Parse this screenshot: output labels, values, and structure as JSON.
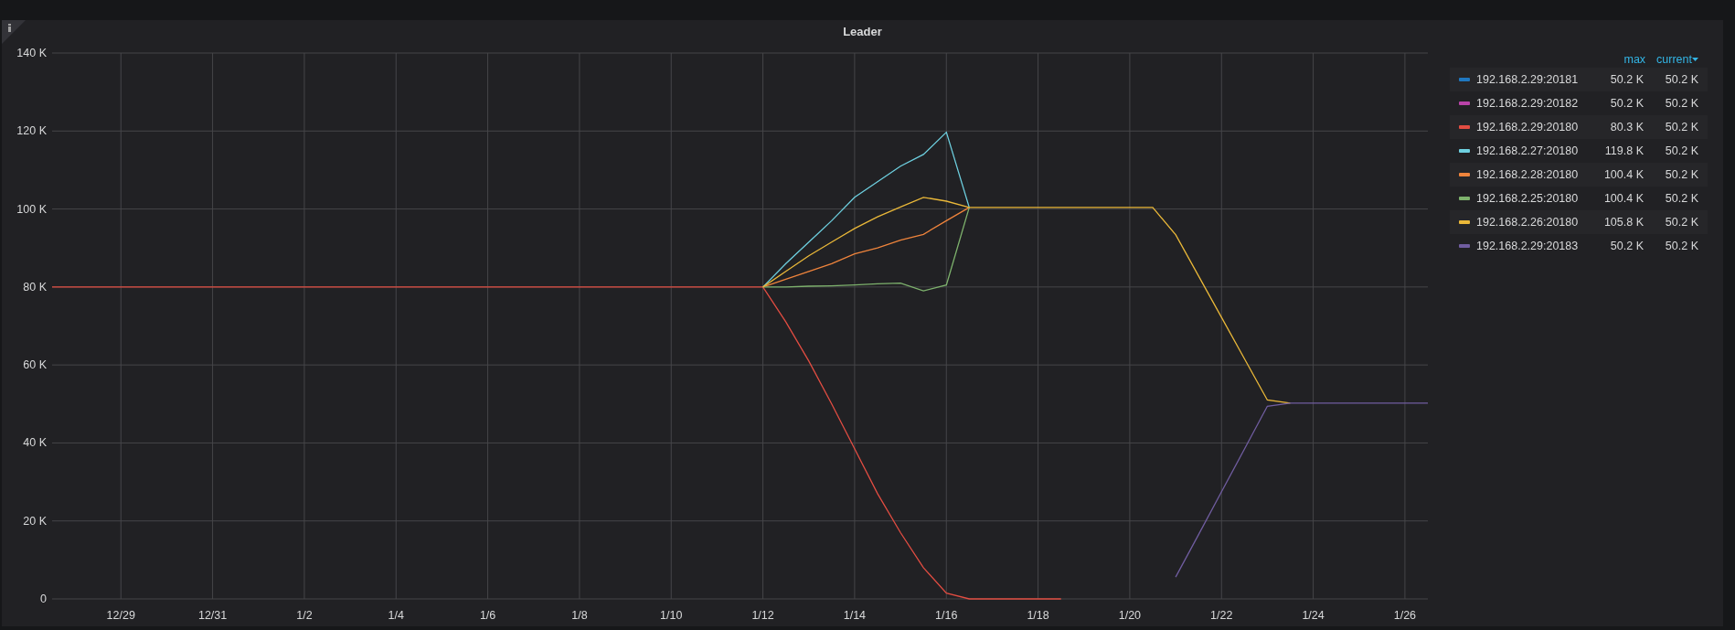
{
  "panel": {
    "title": "Leader",
    "chart_data": {
      "type": "line",
      "categories": [
        null,
        null,
        null,
        "12/29",
        null,
        null,
        null,
        "12/31",
        null,
        null,
        null,
        "1/2",
        null,
        null,
        null,
        "1/4",
        null,
        null,
        null,
        "1/6",
        null,
        null,
        null,
        "1/8",
        null,
        null,
        null,
        "1/10",
        null,
        null,
        null,
        "1/12",
        null,
        null,
        null,
        "1/14",
        null,
        null,
        null,
        "1/16",
        null,
        null,
        null,
        "1/18",
        null,
        null,
        null,
        "1/20",
        null,
        null,
        null,
        "1/22",
        null,
        null,
        null,
        "1/24",
        null,
        null,
        null,
        "1/26",
        null
      ],
      "series": [
        {
          "name": "192.168.2.29:20181",
          "color": "#1f78c1",
          "values": [
            null,
            null,
            null,
            null,
            null,
            null,
            null,
            null,
            null,
            null,
            null,
            null,
            null,
            null,
            null,
            null,
            null,
            null,
            null,
            null,
            null,
            null,
            null,
            null,
            null,
            null,
            null,
            null,
            null,
            null,
            null,
            null,
            null,
            null,
            null,
            null,
            null,
            null,
            null,
            null,
            null,
            null,
            null,
            null,
            null,
            null,
            null,
            null,
            null,
            null,
            null,
            null,
            null,
            null,
            null,
            null,
            null,
            null,
            null,
            null,
            null
          ]
        },
        {
          "name": "192.168.2.29:20182",
          "color": "#ba43a9",
          "values": [
            null,
            null,
            null,
            null,
            null,
            null,
            null,
            null,
            null,
            null,
            null,
            null,
            null,
            null,
            null,
            null,
            null,
            null,
            null,
            null,
            null,
            null,
            null,
            null,
            null,
            null,
            null,
            null,
            null,
            null,
            null,
            null,
            null,
            null,
            null,
            null,
            null,
            null,
            null,
            null,
            null,
            null,
            null,
            null,
            null,
            null,
            null,
            null,
            null,
            null,
            null,
            null,
            null,
            null,
            null,
            null,
            null,
            null,
            null,
            null,
            null
          ]
        },
        {
          "name": "192.168.2.29:20180",
          "color": "#e24d42",
          "values": [
            80,
            80,
            80,
            80,
            80,
            80,
            80,
            80,
            80,
            80,
            80,
            80,
            80,
            80,
            80,
            80,
            80,
            80,
            80,
            80,
            80,
            80,
            80,
            80,
            80,
            80,
            80,
            80,
            80,
            80,
            80,
            80,
            71,
            61,
            50,
            38.5,
            27,
            17,
            8,
            1.5,
            0,
            0,
            0,
            0,
            0,
            null,
            null,
            null,
            null,
            null,
            null,
            null,
            null,
            null,
            null,
            null,
            null,
            null,
            null,
            null,
            null
          ]
        },
        {
          "name": "192.168.2.27:20180",
          "color": "#6ed0e0",
          "values": [
            null,
            null,
            null,
            null,
            null,
            null,
            null,
            null,
            null,
            null,
            null,
            null,
            null,
            null,
            null,
            null,
            null,
            null,
            null,
            null,
            null,
            null,
            null,
            null,
            null,
            null,
            null,
            null,
            null,
            null,
            null,
            80,
            86,
            91.5,
            97,
            103,
            107,
            111,
            114,
            119.7,
            100.4,
            null,
            null,
            null,
            null,
            null,
            null,
            null,
            null,
            null,
            null,
            null,
            null,
            null,
            null,
            null,
            null,
            null,
            null,
            null,
            null
          ]
        },
        {
          "name": "192.168.2.28:20180",
          "color": "#ef843c",
          "values": [
            null,
            null,
            null,
            null,
            null,
            null,
            null,
            null,
            null,
            null,
            null,
            null,
            null,
            null,
            null,
            null,
            null,
            null,
            null,
            null,
            null,
            null,
            null,
            null,
            null,
            null,
            null,
            null,
            null,
            null,
            null,
            80,
            82,
            84,
            86,
            88.5,
            90,
            92,
            93.5,
            97,
            100.4,
            null,
            null,
            null,
            null,
            null,
            null,
            null,
            null,
            null,
            null,
            null,
            null,
            null,
            null,
            null,
            null,
            null,
            null,
            null,
            null
          ]
        },
        {
          "name": "192.168.2.25:20180",
          "color": "#7eb26d",
          "values": [
            null,
            null,
            null,
            null,
            null,
            null,
            null,
            null,
            null,
            null,
            null,
            null,
            null,
            null,
            null,
            null,
            null,
            null,
            null,
            null,
            null,
            null,
            null,
            null,
            null,
            null,
            null,
            null,
            null,
            null,
            null,
            80,
            80,
            80.2,
            80.3,
            80.5,
            80.8,
            81,
            79,
            80.5,
            100.4,
            null,
            null,
            null,
            null,
            null,
            null,
            null,
            null,
            null,
            null,
            null,
            null,
            null,
            null,
            null,
            null,
            null,
            null,
            null,
            null
          ]
        },
        {
          "name": "192.168.2.26:20180",
          "color": "#eab839",
          "values": [
            null,
            null,
            null,
            null,
            null,
            null,
            null,
            null,
            null,
            null,
            null,
            null,
            null,
            null,
            null,
            null,
            null,
            null,
            null,
            null,
            null,
            null,
            null,
            null,
            null,
            null,
            null,
            null,
            null,
            null,
            null,
            80,
            84,
            88,
            91.5,
            95,
            98,
            100.5,
            103,
            102,
            100.4,
            100.4,
            100.4,
            100.4,
            100.4,
            100.4,
            100.4,
            100.4,
            100.4,
            93.4,
            82.8,
            72.2,
            61.6,
            51,
            50.2,
            null,
            null,
            null,
            null,
            null,
            null
          ]
        },
        {
          "name": "192.168.2.29:20183",
          "color": "#705da0",
          "values": [
            null,
            null,
            null,
            null,
            null,
            null,
            null,
            null,
            null,
            null,
            null,
            null,
            null,
            null,
            null,
            null,
            null,
            null,
            null,
            null,
            null,
            null,
            null,
            null,
            null,
            null,
            null,
            null,
            null,
            null,
            null,
            null,
            null,
            null,
            null,
            null,
            null,
            null,
            null,
            null,
            null,
            null,
            null,
            null,
            null,
            null,
            null,
            null,
            null,
            5.6,
            16.5,
            27.5,
            38.4,
            49.4,
            50.2,
            50.2,
            50.2,
            50.2,
            50.2,
            50.2,
            50.2
          ]
        }
      ],
      "ylim": [
        0,
        140
      ],
      "grid": true,
      "yticks": [
        {
          "value": 0,
          "label": "0"
        },
        {
          "value": 20,
          "label": "20 K"
        },
        {
          "value": 40,
          "label": "40 K"
        },
        {
          "value": 60,
          "label": "60 K"
        },
        {
          "value": 80,
          "label": "80 K"
        },
        {
          "value": 100,
          "label": "100 K"
        },
        {
          "value": 120,
          "label": "120 K"
        },
        {
          "value": 140,
          "label": "140 K"
        }
      ]
    },
    "legend": {
      "columns": [
        {
          "label": "max",
          "sorted": false
        },
        {
          "label": "current",
          "sorted": true
        }
      ],
      "rows": [
        {
          "max": "50.2 K",
          "current": "50.2 K"
        },
        {
          "max": "50.2 K",
          "current": "50.2 K"
        },
        {
          "max": "80.3 K",
          "current": "50.2 K"
        },
        {
          "max": "119.8 K",
          "current": "50.2 K"
        },
        {
          "max": "100.4 K",
          "current": "50.2 K"
        },
        {
          "max": "100.4 K",
          "current": "50.2 K"
        },
        {
          "max": "105.8 K",
          "current": "50.2 K"
        },
        {
          "max": "50.2 K",
          "current": "50.2 K"
        }
      ]
    }
  }
}
